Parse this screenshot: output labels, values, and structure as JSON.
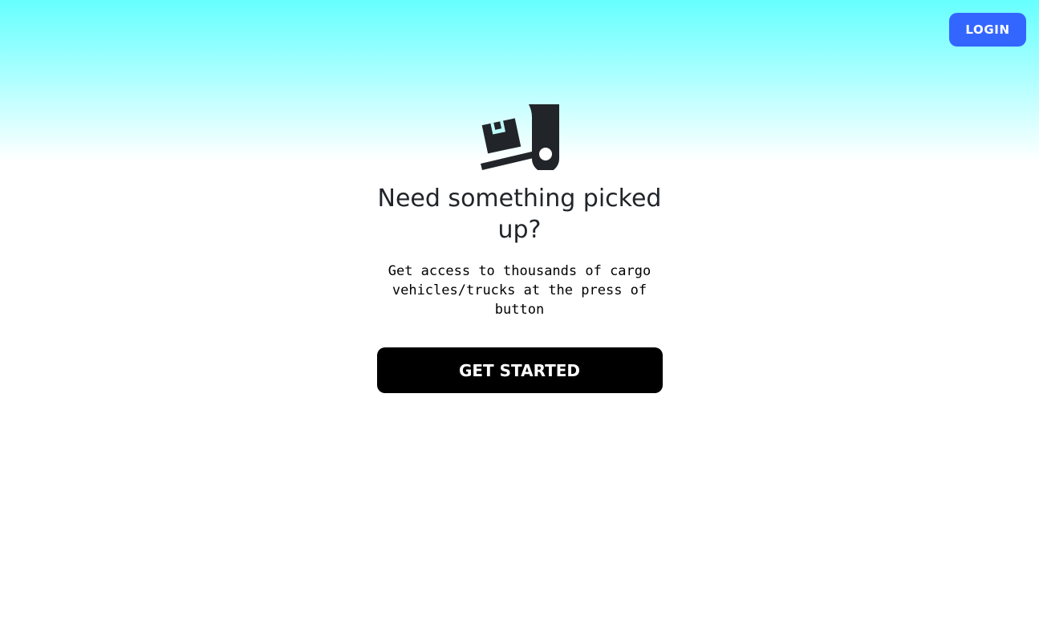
{
  "header": {
    "login_label": "LOGIN"
  },
  "hero": {
    "icon": "dolly-box-icon",
    "title": "Need something picked up?",
    "subtitle": "Get access to thousands of cargo vehicles/trucks at the press of button",
    "cta_label": "GET STARTED"
  },
  "colors": {
    "login_button_bg": "#3366ff",
    "cta_button_bg": "#000000",
    "gradient_top": "#66ffff",
    "background": "#ffffff",
    "text": "#212529"
  }
}
